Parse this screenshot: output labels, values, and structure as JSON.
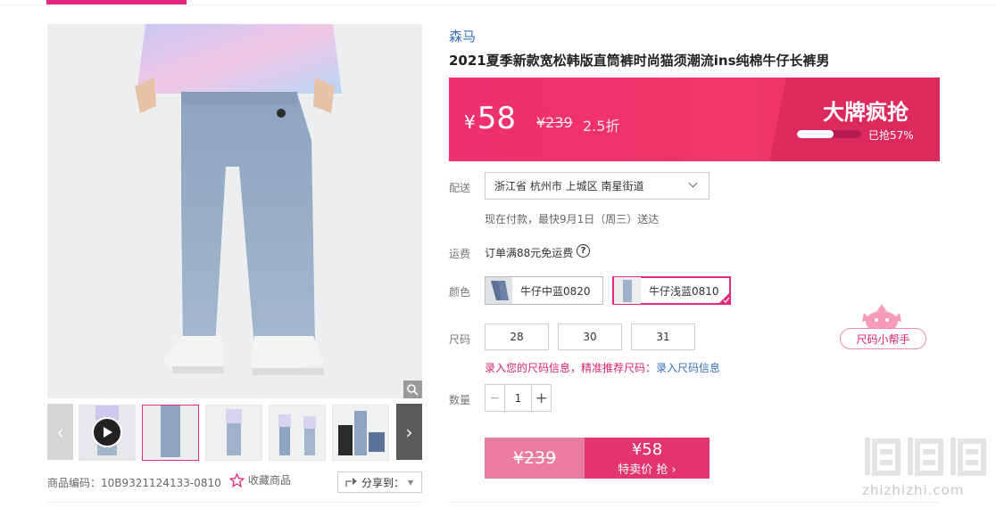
{
  "product": {
    "brand": "森马",
    "title": "2021夏季新款宽松韩版直筒裤时尚猫须潮流ins纯棉牛仔长裤男",
    "sku_code": "商品编码：10B9321124133-0810",
    "favorite_label": "收藏商品",
    "share_label": "分享到："
  },
  "price": {
    "currency": "¥",
    "current": "58",
    "original": "¥239",
    "discount": "2.5折",
    "promo_title": "大牌疯抢",
    "sold_pct": 0.57,
    "sold_label": "已抢57%"
  },
  "shipping": {
    "label": "配送",
    "address": "浙江省 杭州市 上城区 南星街道",
    "eta": "现在付款，最快9月1日（周三）送达"
  },
  "freight": {
    "label": "运费",
    "text": "订单满88元免运费"
  },
  "color": {
    "label": "颜色",
    "options": [
      "牛仔中蓝0820",
      "牛仔浅蓝0810"
    ],
    "selected": "牛仔浅蓝0810"
  },
  "size": {
    "label": "尺码",
    "options": [
      "28",
      "30",
      "31"
    ],
    "hint": "录入您的尺码信息，精准推荐尺码：",
    "hint_link": "录入尺码信息",
    "helper": "尺码小帮手"
  },
  "quantity": {
    "label": "数量",
    "value": "1",
    "minus": "−",
    "plus": "+"
  },
  "buy": {
    "original": "¥239",
    "price": "¥58",
    "cta": "特卖价 抢 ›"
  },
  "watermark": "zhizhizhi.com",
  "colors": {
    "accent": "#e4287c",
    "price_bar": "#ee2f6e",
    "brand_link": "#3a6fb5"
  }
}
